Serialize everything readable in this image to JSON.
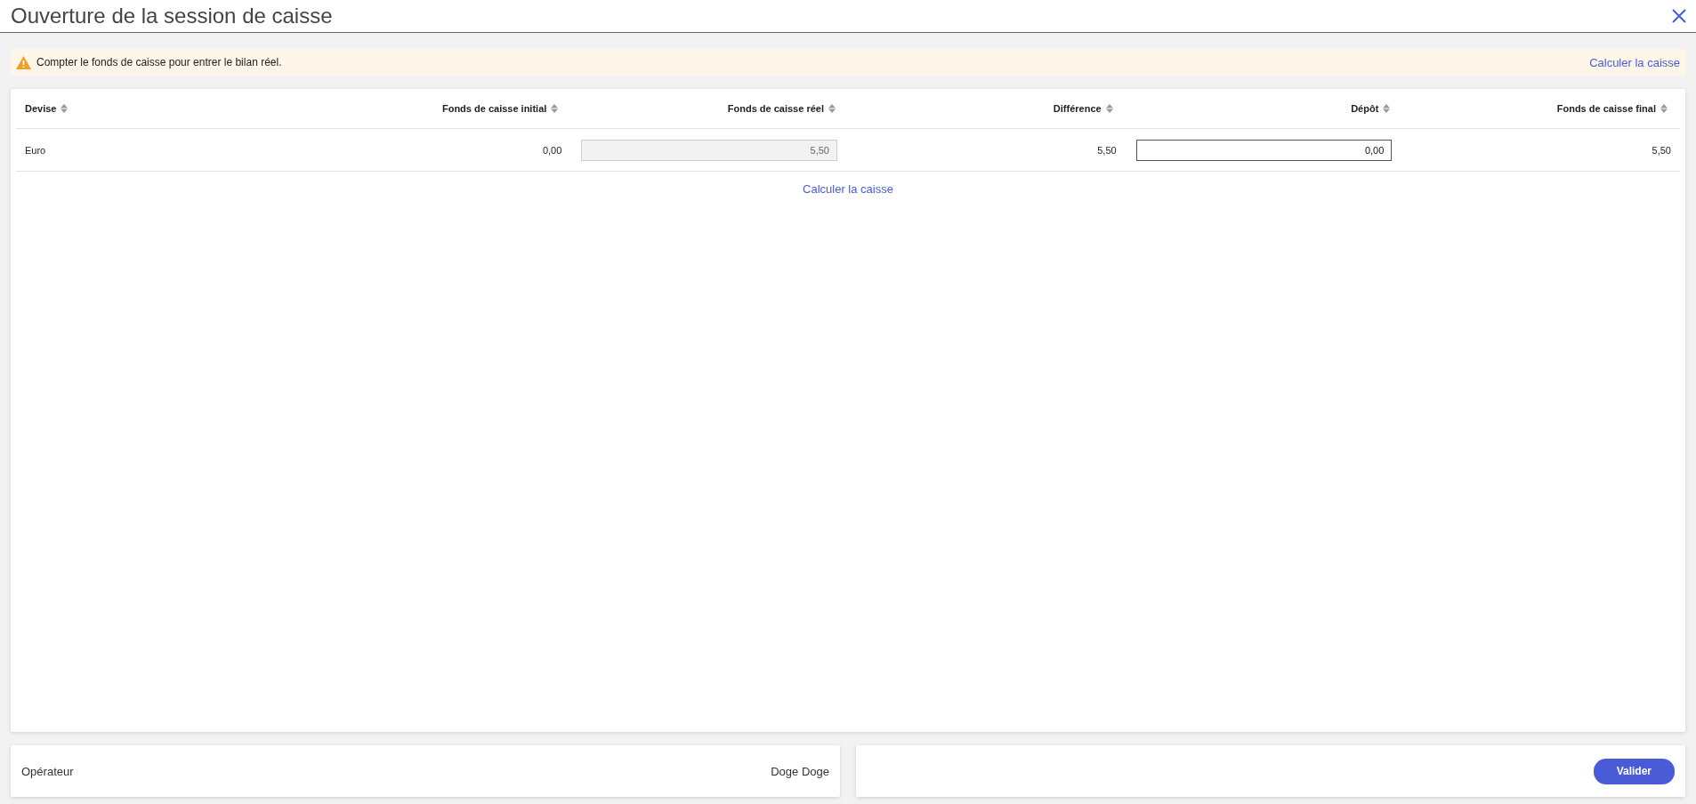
{
  "window": {
    "title": "Ouverture de la session de caisse"
  },
  "alert": {
    "message": "Compter le fonds de caisse pour entrer le bilan réel.",
    "link": "Calculer la caisse"
  },
  "table": {
    "columns": [
      "Devise",
      "Fonds de caisse initial",
      "Fonds de caisse réel",
      "Différence",
      "Dépôt",
      "Fonds de caisse final"
    ],
    "rows": [
      {
        "cells": [
          {
            "kind": "text",
            "value": "Euro"
          },
          {
            "kind": "text",
            "value": "0,00"
          },
          {
            "kind": "input",
            "value": "5,50",
            "disabled": true
          },
          {
            "kind": "text",
            "value": "5,50"
          },
          {
            "kind": "input",
            "value": "0,00",
            "disabled": false
          },
          {
            "kind": "text",
            "value": "5,50"
          }
        ]
      }
    ],
    "link": "Calculer la caisse"
  },
  "operator": {
    "label": "Opérateur",
    "value": "Doge Doge"
  },
  "buttons": [
    "Valider"
  ]
}
